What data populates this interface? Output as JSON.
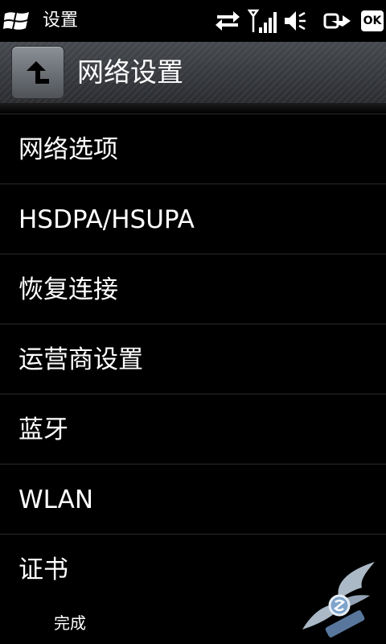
{
  "status_bar": {
    "title": "设置",
    "ok_label": "OK",
    "icons": [
      "windows-start-icon",
      "data-transfer-icon",
      "signal-strength-icon",
      "volume-icon",
      "power-icon",
      "ok-icon"
    ]
  },
  "header": {
    "title": "网络设置",
    "back_icon": "back-up-arrow-icon"
  },
  "menu": {
    "items": [
      {
        "label": "网络选项"
      },
      {
        "label": "HSDPA/HSUPA"
      },
      {
        "label": "恢复连接"
      },
      {
        "label": "运营商设置"
      },
      {
        "label": "蓝牙"
      },
      {
        "label": "WLAN"
      },
      {
        "label": "证书"
      }
    ]
  },
  "softkeys": {
    "left": "完成"
  },
  "watermark": {
    "icon": "winged-logo-watermark"
  }
}
